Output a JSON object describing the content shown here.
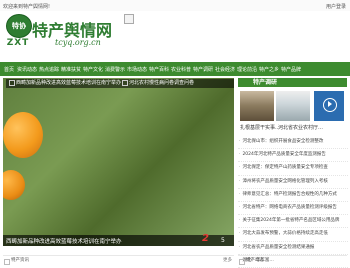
{
  "topbar": {
    "welcome": "欢迎来到特产舆情网!",
    "login": "用户登录"
  },
  "header": {
    "logo_text": "特协",
    "logo_zxt": "ZXT",
    "site_name": "特产舆情网",
    "site_url": "tcyq.org.cn"
  },
  "nav": {
    "items": [
      "首页",
      "资讯动态",
      "热点追踪",
      "精准扶贫",
      "特产文化",
      "消费警示",
      "市场动态",
      "特产百科",
      "农业科普",
      "特产调研",
      "社会经济",
      "理论前沿",
      "特产之乡",
      "特产品牌"
    ]
  },
  "slide": {
    "top_caption": "西畴加新品种改进高效蓝莓技术培训在南宁举办",
    "top_caption_extra": "河北农村慢性病问卷调查问卷",
    "bottom_caption": "西畴加新品种改进高效蓝莓技术培训在南宁举办",
    "page_current": "2",
    "page_total": "5"
  },
  "sidebar": {
    "heading": "特产调研",
    "thumbs": [
      {
        "caption": "扎根基层干实事…"
      },
      {
        "caption": "河北省农业农村厅…"
      },
      {
        "caption": ""
      }
    ],
    "list": [
      "河北保山市：组织开展食品安全检测整改",
      "2024年河北特产品质量安全年度监测报告",
      "河北保定：保定特产山药质量安全专项检查",
      "漳州将农产品质量安全网格化管理列入考核",
      "律师意见汇总：特产检测报告合规性的几种方式",
      "河北省特产：网络电商农产品质量检测评级报告",
      "关于征集2024年第一批省特产名品区域公用品牌",
      "河北大蒜发布预警，大蒜价格持续走高走低",
      "河北省农产品质量安全检测结果通报",
      "湖北：年年富…"
    ]
  },
  "footer": {
    "left_text": "特产资讯",
    "left_more": "更多",
    "right_text": "特产动态"
  },
  "colors": {
    "nav_green": "#3d8b2f",
    "brand_green": "#2f7d32",
    "accent_red": "#e53935"
  }
}
